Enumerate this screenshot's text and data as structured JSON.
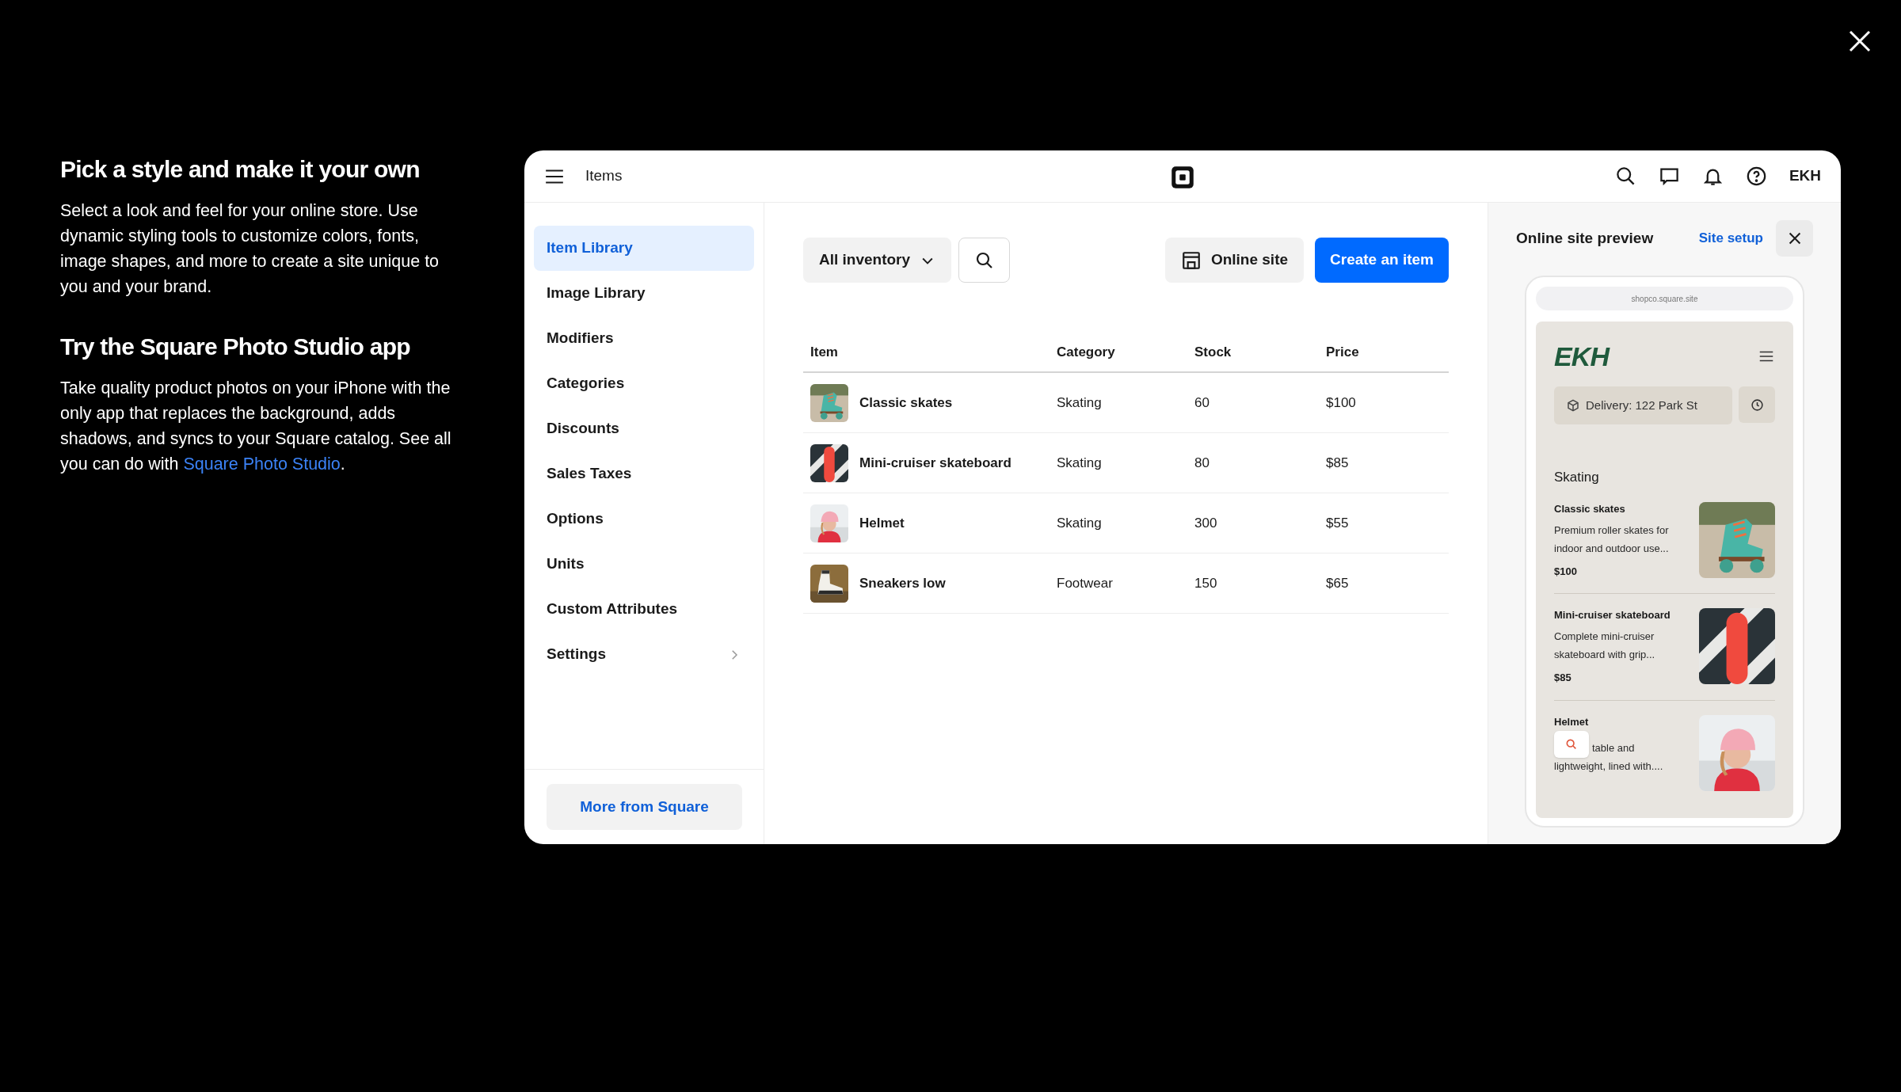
{
  "intro": [
    {
      "heading": "Pick a style and make it your own",
      "body": "Select a look and feel for your online store. Use dynamic styling tools to customize colors, fonts, image shapes, and more to create a site unique to you and your brand."
    },
    {
      "heading": "Try the Square Photo Studio app",
      "body": "Take quality product photos on your iPhone with the only app that replaces the background, adds shadows, and syncs to your Square catalog. See all you can do with ",
      "link": "Square Photo Studio",
      "after": "."
    }
  ],
  "header": {
    "title": "Items",
    "account": "EKH"
  },
  "sidebar": {
    "items": [
      {
        "label": "Item Library",
        "selected": true,
        "has_submenu": false
      },
      {
        "label": "Image Library",
        "selected": false,
        "has_submenu": false
      },
      {
        "label": "Modifiers",
        "selected": false,
        "has_submenu": false
      },
      {
        "label": "Categories",
        "selected": false,
        "has_submenu": false
      },
      {
        "label": "Discounts",
        "selected": false,
        "has_submenu": false
      },
      {
        "label": "Sales Taxes",
        "selected": false,
        "has_submenu": false
      },
      {
        "label": "Options",
        "selected": false,
        "has_submenu": false
      },
      {
        "label": "Units",
        "selected": false,
        "has_submenu": false
      },
      {
        "label": "Custom Attributes",
        "selected": false,
        "has_submenu": false
      },
      {
        "label": "Settings",
        "selected": false,
        "has_submenu": true
      }
    ],
    "footer_button": "More from Square"
  },
  "toolbar": {
    "filter": "All inventory",
    "online_site": "Online site",
    "create": "Create an item"
  },
  "table": {
    "columns": [
      "Item",
      "Category",
      "Stock",
      "Price"
    ],
    "rows": [
      {
        "item": "Classic skates",
        "category": "Skating",
        "stock": "60",
        "price": "$100"
      },
      {
        "item": "Mini-cruiser skateboard",
        "category": "Skating",
        "stock": "80",
        "price": "$85"
      },
      {
        "item": "Helmet",
        "category": "Skating",
        "stock": "300",
        "price": "$55"
      },
      {
        "item": "Sneakers low",
        "category": "Footwear",
        "stock": "150",
        "price": "$65"
      }
    ]
  },
  "preview": {
    "title": "Online site preview",
    "setup_link": "Site setup",
    "url": "shopco.square.site",
    "logo": "EKH",
    "delivery": "Delivery: 122 Park St",
    "section": "Skating",
    "products": [
      {
        "name": "Classic skates",
        "description": "Premium roller skates for indoor and outdoor use...",
        "price": "$100"
      },
      {
        "name": "Mini-cruiser skateboard",
        "description": "Complete mini-cruiser skateboard with grip...",
        "price": "$85"
      },
      {
        "name": "Helmet",
        "description_lines": [
          "table and",
          "lightweight, lined with...."
        ],
        "covered": true
      }
    ]
  }
}
